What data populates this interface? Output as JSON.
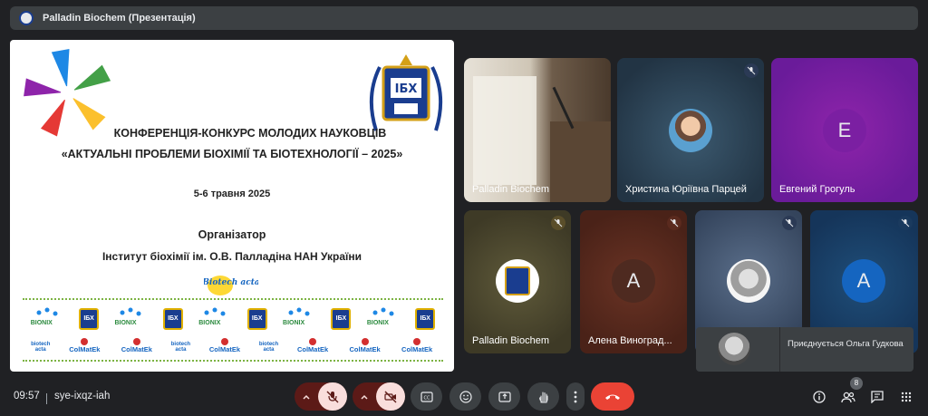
{
  "window": {
    "title": "Palladin Biochem (Презентація)"
  },
  "slide": {
    "line1": "КОНФЕРЕНЦІЯ-КОНКУРС МОЛОДИХ НАУКОВЦІВ",
    "line2": "«АКТУАЛЬНІ ПРОБЛЕМИ БІОХІМІЇ ТА БІОТЕХНОЛОГІЇ – 2025»",
    "dates": "5-6 травня 2025",
    "organizer_label": "Організатор",
    "organizer_name": "Інститут біохімії ім. О.В. Палладіна НАН України",
    "crest_text": "ІБХ",
    "biotech_logo": "Biotech acta",
    "partner_bionix": "BIONIX",
    "partner_colmatek": "ColMatEk",
    "partner_crest": "ІБХ",
    "partner_bt": "biotech acta"
  },
  "participants": [
    {
      "name": "Palladin Biochem",
      "muted": false,
      "type": "video"
    },
    {
      "name": "Христина Юріївна Парцей",
      "muted": true,
      "type": "photo"
    },
    {
      "name": "Евгений Грогуль",
      "muted": false,
      "type": "letter",
      "letter": "E",
      "color": "#7b1fa2"
    },
    {
      "name": "Palladin Biochem",
      "muted": true,
      "type": "crest"
    },
    {
      "name": "Алена Виноград...",
      "muted": true,
      "type": "letter",
      "letter": "A",
      "color": "#4e2a20"
    },
    {
      "name": "",
      "muted": true,
      "type": "photo"
    },
    {
      "name": "",
      "muted": true,
      "type": "letter",
      "letter": "A",
      "color": "#1565c0"
    }
  ],
  "toast": {
    "message": "Приєднується Ольга Гудкова"
  },
  "bottombar": {
    "time": "09:57",
    "meeting_code": "sye-ixqz-iah",
    "people_count": "8"
  },
  "colors": {
    "background": "#202124",
    "hangup": "#ea4335",
    "muted_pill": "#f9dedc"
  }
}
